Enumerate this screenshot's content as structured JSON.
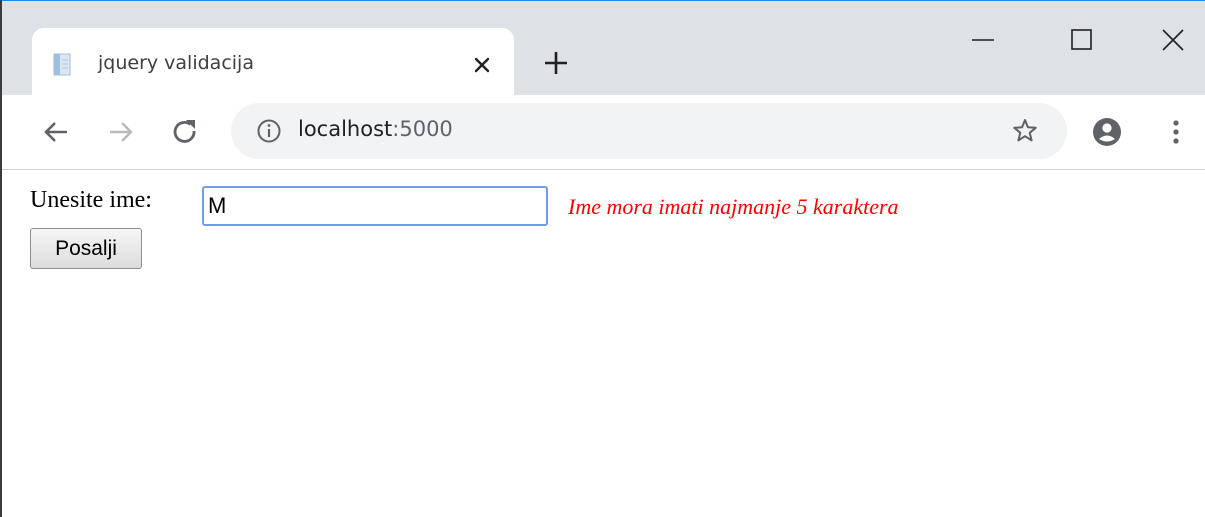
{
  "tab": {
    "title": "jquery validacija",
    "favicon": "page-icon",
    "close_icon": "close-icon"
  },
  "new_tab_icon": "plus-icon",
  "window_controls": {
    "minimize": "minimize-icon",
    "maximize": "maximize-icon",
    "close": "close-icon"
  },
  "toolbar": {
    "back_icon": "arrow-left-icon",
    "forward_icon": "arrow-right-icon",
    "reload_icon": "reload-icon",
    "info_icon": "info-icon",
    "url_host": "localhost",
    "url_port": ":5000",
    "bookmark_icon": "star-icon",
    "profile_icon": "account-icon",
    "menu_icon": "kebab-menu-icon"
  },
  "form": {
    "label": "Unesite ime:",
    "input_value": "M",
    "error": "Ime mora imati najmanje 5 karaktera",
    "submit_label": "Posalji"
  },
  "colors": {
    "tabstrip": "#dee1e6",
    "omnibox": "#f1f3f4",
    "error": "#ff0000",
    "input_focus_border": "#6f9de6"
  }
}
